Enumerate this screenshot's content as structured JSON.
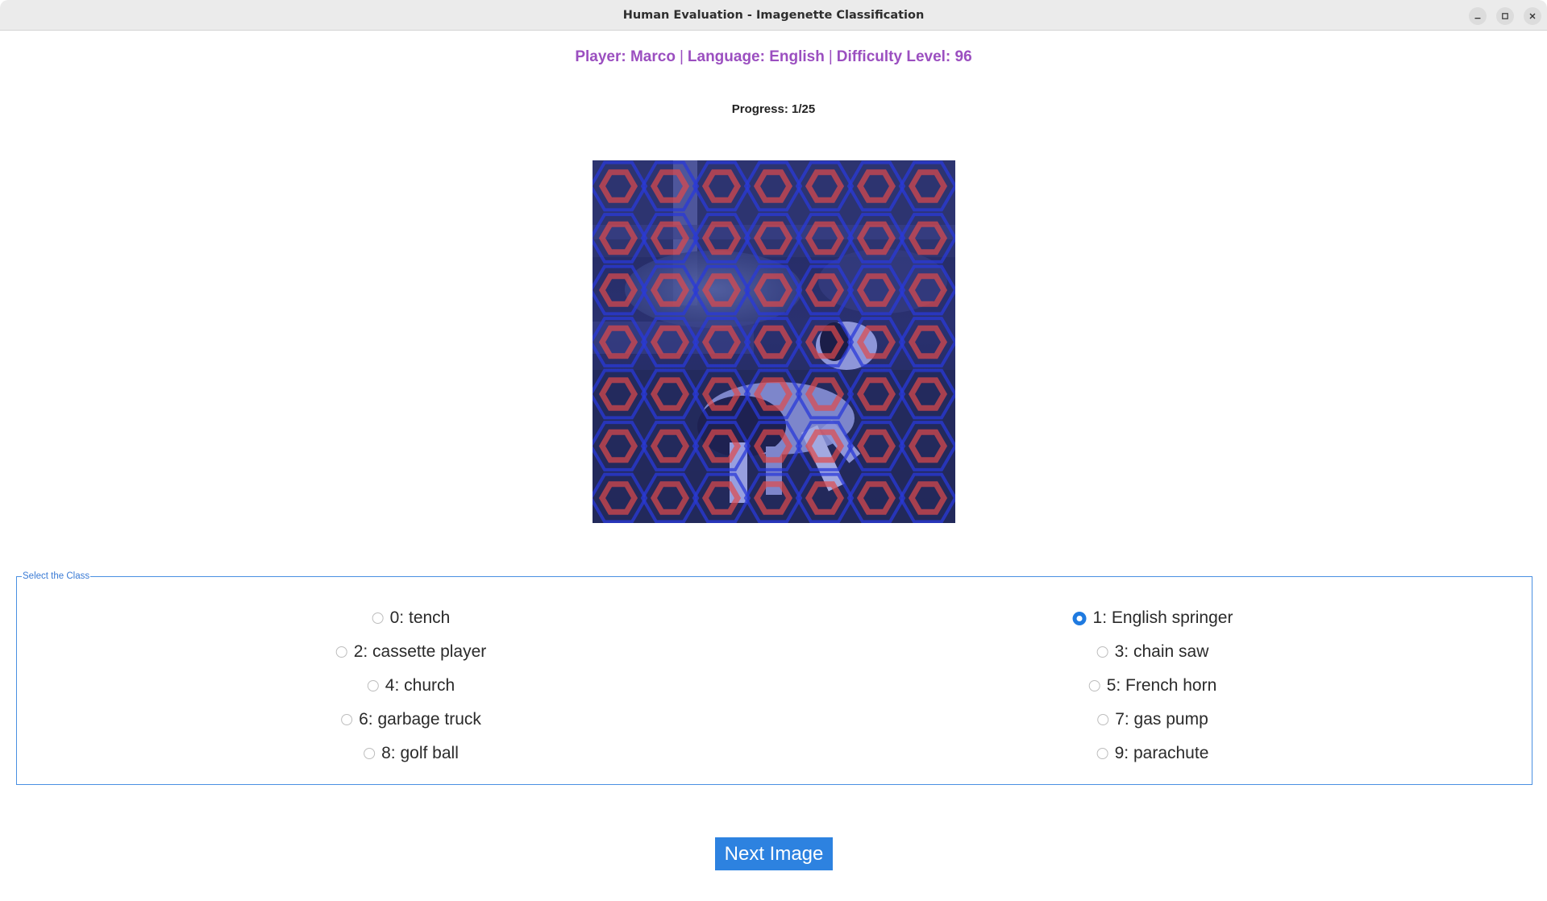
{
  "window": {
    "title": "Human Evaluation - Imagenette Classification"
  },
  "header": {
    "player": "Player: Marco",
    "language": "Language: English",
    "difficulty": "Difficulty Level: 96",
    "separator": "|",
    "progress": "Progress: 1/25"
  },
  "group": {
    "legend": "Select the Class",
    "selected": "1",
    "options": [
      {
        "id": "0",
        "label": "0: tench"
      },
      {
        "id": "1",
        "label": "1: English springer"
      },
      {
        "id": "2",
        "label": "2: cassette player"
      },
      {
        "id": "3",
        "label": "3: chain saw"
      },
      {
        "id": "4",
        "label": "4: church"
      },
      {
        "id": "5",
        "label": "5: French horn"
      },
      {
        "id": "6",
        "label": "6: garbage truck"
      },
      {
        "id": "7",
        "label": "7: gas pump"
      },
      {
        "id": "8",
        "label": "8: golf ball"
      },
      {
        "id": "9",
        "label": "9: parachute"
      }
    ]
  },
  "actions": {
    "next_label": "Next Image"
  },
  "colors": {
    "header_purple": "#9b4fc0",
    "accent_blue": "#2d82e0",
    "radio_selected": "#1f7ae0",
    "group_border": "#4a90e2"
  }
}
